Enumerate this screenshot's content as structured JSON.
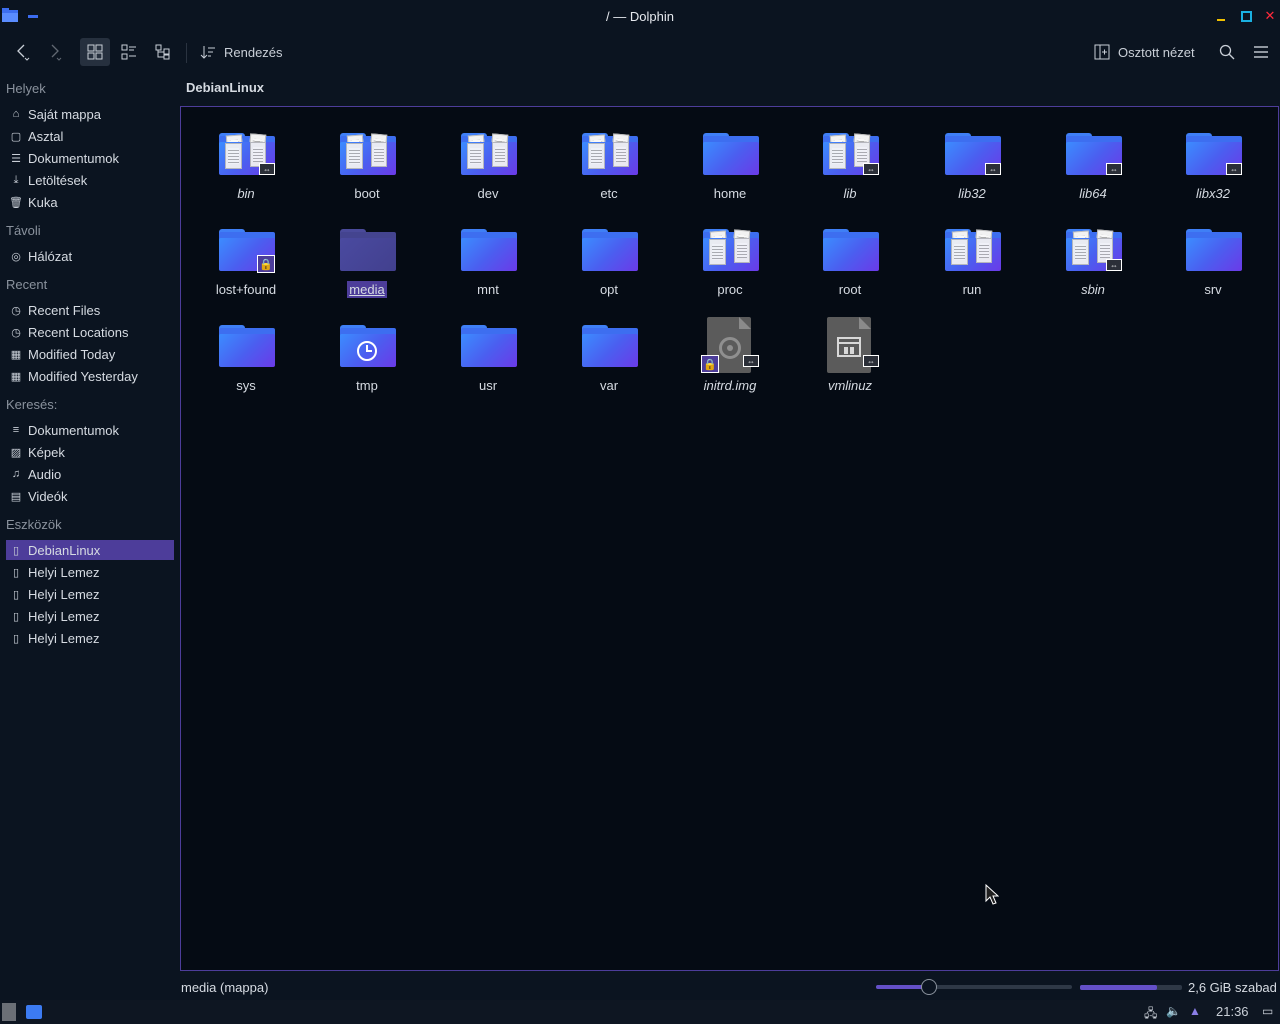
{
  "window": {
    "title": "/ — Dolphin"
  },
  "toolbar": {
    "sort_label": "Rendezés",
    "split_label": "Osztott nézet"
  },
  "sidebar": {
    "sections": [
      {
        "title": "Helyek",
        "items": [
          {
            "label": "Saját mappa",
            "icon": "home-icon"
          },
          {
            "label": "Asztal",
            "icon": "desktop-icon"
          },
          {
            "label": "Dokumentumok",
            "icon": "documents-icon"
          },
          {
            "label": "Letöltések",
            "icon": "download-icon"
          },
          {
            "label": "Kuka",
            "icon": "trash-icon"
          }
        ]
      },
      {
        "title": "Távoli",
        "items": [
          {
            "label": "Hálózat",
            "icon": "network-icon"
          }
        ]
      },
      {
        "title": "Recent",
        "items": [
          {
            "label": "Recent Files",
            "icon": "recent-icon"
          },
          {
            "label": "Recent Locations",
            "icon": "recent-icon"
          },
          {
            "label": "Modified Today",
            "icon": "calendar-icon"
          },
          {
            "label": "Modified Yesterday",
            "icon": "calendar-icon"
          }
        ]
      },
      {
        "title": "Keresés:",
        "items": [
          {
            "label": "Dokumentumok",
            "icon": "text-icon"
          },
          {
            "label": "Képek",
            "icon": "image-icon"
          },
          {
            "label": "Audio",
            "icon": "music-icon"
          },
          {
            "label": "Videók",
            "icon": "video-icon"
          }
        ]
      },
      {
        "title": "Eszközök",
        "items": [
          {
            "label": "DebianLinux",
            "icon": "drive-icon",
            "active": true
          },
          {
            "label": "Helyi Lemez",
            "icon": "drive-icon"
          },
          {
            "label": "Helyi Lemez",
            "icon": "drive-icon"
          },
          {
            "label": "Helyi Lemez",
            "icon": "drive-icon"
          },
          {
            "label": "Helyi Lemez",
            "icon": "drive-icon"
          }
        ]
      }
    ]
  },
  "location": "DebianLinux",
  "files": [
    {
      "name": "bin",
      "kind": "folder",
      "papers": true,
      "link": true,
      "italic": true
    },
    {
      "name": "boot",
      "kind": "folder",
      "papers": true
    },
    {
      "name": "dev",
      "kind": "folder",
      "papers": true
    },
    {
      "name": "etc",
      "kind": "folder",
      "papers": true
    },
    {
      "name": "home",
      "kind": "folder"
    },
    {
      "name": "lib",
      "kind": "folder",
      "papers": true,
      "link": true,
      "italic": true
    },
    {
      "name": "lib32",
      "kind": "folder",
      "link": true,
      "italic": true
    },
    {
      "name": "lib64",
      "kind": "folder",
      "link": true,
      "italic": true
    },
    {
      "name": "libx32",
      "kind": "folder",
      "link": true,
      "italic": true
    },
    {
      "name": "lost+found",
      "kind": "folder",
      "lock": true
    },
    {
      "name": "media",
      "kind": "folder",
      "dim": true,
      "selected": true
    },
    {
      "name": "mnt",
      "kind": "folder"
    },
    {
      "name": "opt",
      "kind": "folder"
    },
    {
      "name": "proc",
      "kind": "folder",
      "papers": true
    },
    {
      "name": "root",
      "kind": "folder"
    },
    {
      "name": "run",
      "kind": "folder",
      "papers": true
    },
    {
      "name": "sbin",
      "kind": "folder",
      "papers": true,
      "link": true,
      "italic": true
    },
    {
      "name": "srv",
      "kind": "folder"
    },
    {
      "name": "sys",
      "kind": "folder"
    },
    {
      "name": "tmp",
      "kind": "folder",
      "clock": true
    },
    {
      "name": "usr",
      "kind": "folder"
    },
    {
      "name": "var",
      "kind": "folder"
    },
    {
      "name": "initrd.img",
      "kind": "disc-image",
      "link": true,
      "lock": true,
      "italic": true
    },
    {
      "name": "vmlinuz",
      "kind": "executable",
      "link": true,
      "italic": true
    }
  ],
  "status": {
    "text": "media (mappa)",
    "zoom_fraction": 0.27,
    "space_used_fraction": 0.75,
    "free_space": "2,6 GiB szabad"
  },
  "taskbar": {
    "clock": "21:36"
  },
  "colors": {
    "accent": "#4d3d9a",
    "background": "#050b14",
    "folder_blue": "#3d6ef0"
  }
}
